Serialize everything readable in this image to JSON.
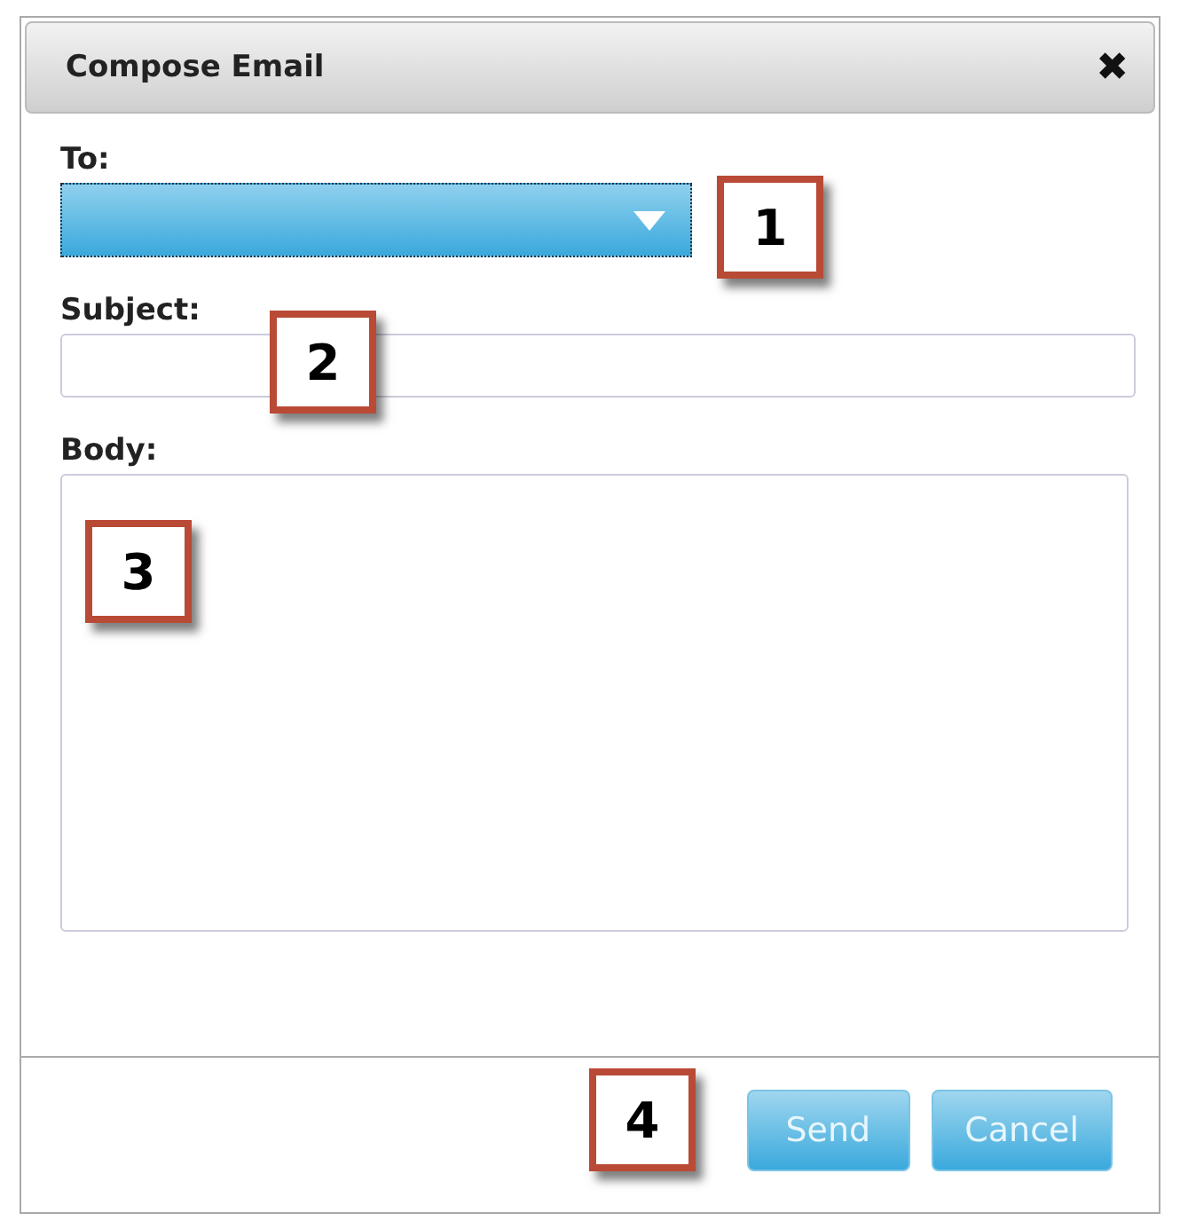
{
  "dialog": {
    "title": "Compose Email",
    "close": "✖"
  },
  "fields": [
    {
      "kind": "select",
      "label": "To:"
    },
    {
      "kind": "text",
      "label": "Subject:"
    },
    {
      "kind": "textarea",
      "label": "Body:"
    }
  ],
  "buttons": [
    {
      "label": "Send"
    },
    {
      "label": "Cancel"
    }
  ],
  "callouts": [
    "1",
    "2",
    "3",
    "4"
  ]
}
